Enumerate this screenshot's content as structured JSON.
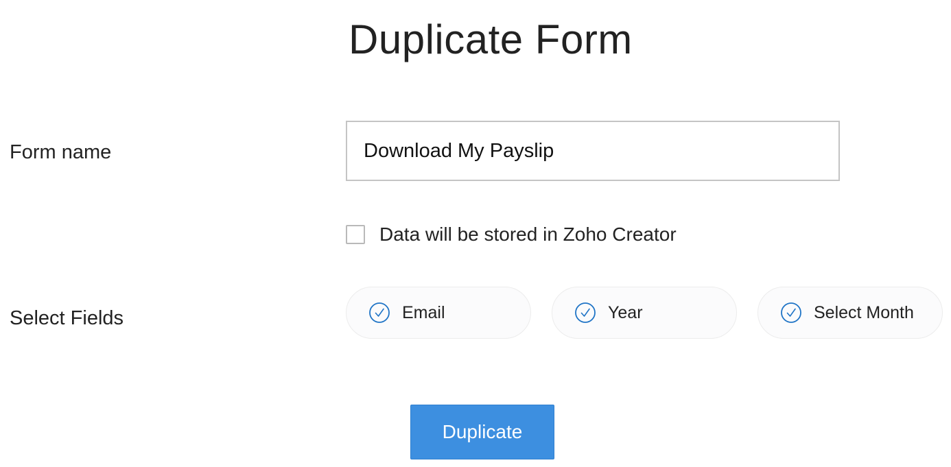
{
  "header": {
    "title": "Duplicate Form"
  },
  "form_name": {
    "label": "Form name",
    "value": "Download My Payslip"
  },
  "storage_option": {
    "label": "Data will be stored in Zoho Creator",
    "checked": false
  },
  "select_fields": {
    "label": "Select Fields",
    "fields": [
      {
        "label": "Email",
        "selected": true,
        "icon": "check-circle-icon"
      },
      {
        "label": "Year",
        "selected": true,
        "icon": "check-circle-icon"
      },
      {
        "label": "Select Month",
        "selected": true,
        "icon": "check-circle-icon"
      }
    ]
  },
  "actions": {
    "duplicate_label": "Duplicate"
  },
  "colors": {
    "accent": "#3d8fe0",
    "check_icon": "#1f74c6",
    "input_border": "#c4c4c4"
  }
}
